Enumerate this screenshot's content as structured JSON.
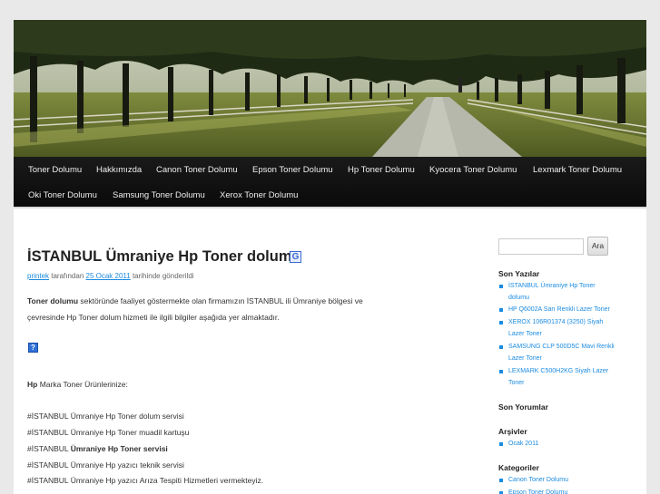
{
  "nav": {
    "items": [
      "Toner Dolumu",
      "Hakkımızda",
      "Canon Toner Dolumu",
      "Epson Toner Dolumu",
      "Hp Toner Dolumu",
      "Kyocera Toner Dolumu",
      "Lexmark Toner Dolumu",
      "Oki Toner Dolumu",
      "Samsung Toner Dolumu",
      "Xerox Toner Dolumu"
    ]
  },
  "post": {
    "title": "İSTANBUL Ümraniye Hp Toner dolumu",
    "title_icon": "G",
    "meta": {
      "author": "printek",
      "by": " tarafından ",
      "date": "25 Ocak 2011",
      "posted": " tarihinde gönderildi"
    },
    "intro_bold": "Toner dolumu",
    "intro_rest": " sektöründe faaliyet göstermekte olan firmamızın İSTANBUL ili Ümraniye bölgesi ve",
    "intro_line2": "çevresinde Hp Toner dolum hizmeti ile ilgili bilgiler aşağıda yer almaktadır.",
    "help_icon": "?",
    "brand_bold": "Hp",
    "brand_rest": " Marka Toner Ürünlerinize:",
    "list": [
      "#İSTANBUL Ümraniye Hp Toner dolum servisi",
      "#İSTANBUL Ümraniye Hp Toner muadil kartuşu",
      "#İSTANBUL ",
      "#İSTANBUL Ümraniye Hp yazıcı teknik servisi",
      "#İSTANBUL Ümraniye Hp yazıcı Arıza Tespiti Hizmetleri vermekteyiz."
    ],
    "list_bold_part": "Ümraniye Hp Toner servisi"
  },
  "sidebar": {
    "search_button": "Ara",
    "search_value": "",
    "recent_title": "Son Yazılar",
    "recent": [
      [
        "İSTANBUL Ümraniye Hp Toner",
        "dolumu"
      ],
      [
        "HP Q6002A Sarı Renkli Lazer Toner"
      ],
      [
        "XEROX 106R01374 (3250) Siyah",
        "Lazer Toner"
      ],
      [
        "SAMSUNG CLP 500D5C Mavi Renkli",
        "Lazer Toner"
      ],
      [
        "LEXMARK C500H2KG Siyah Lazer",
        "Toner"
      ]
    ],
    "comments_title": "Son Yorumlar",
    "archives_title": "Arşivler",
    "archives": [
      "Ocak 2011"
    ],
    "categories_title": "Kategoriler",
    "categories": [
      "Canon Toner Dolumu",
      "Epson Toner Dolumu"
    ]
  },
  "colors": {
    "link": "#1b8be0",
    "nav_bg": "#111111",
    "page_bg": "#e9e9e9"
  }
}
